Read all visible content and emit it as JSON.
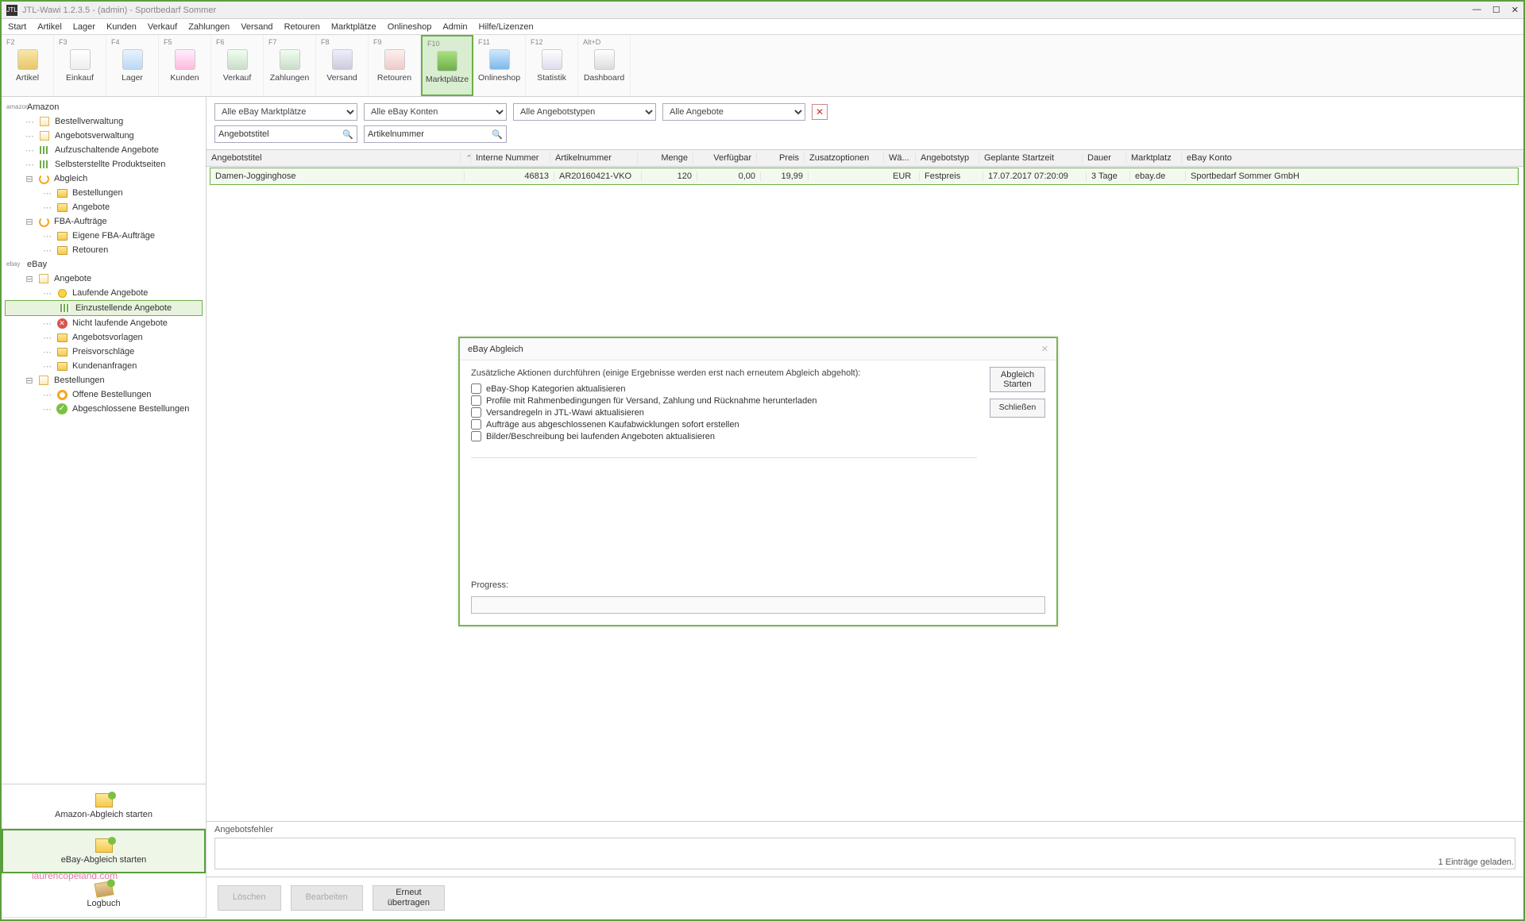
{
  "window": {
    "title": "JTL-Wawi 1.2.3.5 - (admin) - Sportbedarf Sommer",
    "app_badge": "JTL"
  },
  "menu": [
    "Start",
    "Artikel",
    "Lager",
    "Kunden",
    "Verkauf",
    "Zahlungen",
    "Versand",
    "Retouren",
    "Marktplätze",
    "Onlineshop",
    "Admin",
    "Hilfe/Lizenzen"
  ],
  "ribbon": [
    {
      "key": "F2",
      "label": "Artikel"
    },
    {
      "key": "F3",
      "label": "Einkauf"
    },
    {
      "key": "F4",
      "label": "Lager"
    },
    {
      "key": "F5",
      "label": "Kunden"
    },
    {
      "key": "F6",
      "label": "Verkauf"
    },
    {
      "key": "F7",
      "label": "Zahlungen"
    },
    {
      "key": "F8",
      "label": "Versand"
    },
    {
      "key": "F9",
      "label": "Retouren"
    },
    {
      "key": "F10",
      "label": "Marktplätze",
      "active": true
    },
    {
      "key": "F11",
      "label": "Onlineshop"
    },
    {
      "key": "F12",
      "label": "Statistik"
    },
    {
      "key": "Alt+D",
      "label": "Dashboard"
    }
  ],
  "sidebar": {
    "amazon": {
      "header": "Amazon",
      "items": [
        {
          "label": "Bestellverwaltung"
        },
        {
          "label": "Angebotsverwaltung"
        },
        {
          "label": "Aufzuschaltende Angebote",
          "icon": "bars"
        },
        {
          "label": "Selbsterstellte Produktseiten",
          "icon": "bars"
        }
      ],
      "abgleich": {
        "label": "Abgleich",
        "children": [
          {
            "label": "Bestellungen"
          },
          {
            "label": "Angebote"
          }
        ]
      },
      "fba": {
        "label": "FBA-Aufträge",
        "children": [
          {
            "label": "Eigene FBA-Aufträge"
          },
          {
            "label": "Retouren"
          }
        ]
      }
    },
    "ebay": {
      "header": "eBay",
      "angebote": {
        "label": "Angebote",
        "children": [
          {
            "label": "Laufende Angebote",
            "icon": "yell"
          },
          {
            "label": "Einzustellende Angebote",
            "icon": "bars",
            "selected": true
          },
          {
            "label": "Nicht laufende Angebote",
            "icon": "red"
          },
          {
            "label": "Angebotsvorlagen"
          },
          {
            "label": "Preisvorschläge"
          },
          {
            "label": "Kundenanfragen"
          }
        ]
      },
      "bestellungen": {
        "label": "Bestellungen",
        "children": [
          {
            "label": "Offene Bestellungen",
            "icon": "ring"
          },
          {
            "label": "Abgeschlossene Bestellungen",
            "icon": "check"
          }
        ]
      }
    },
    "actions": {
      "amazon": "Amazon-Abgleich starten",
      "ebay": "eBay-Abgleich starten",
      "log": "Logbuch"
    }
  },
  "filters": {
    "marketplaces": "Alle eBay Marktplätze",
    "accounts": "Alle eBay Konten",
    "types": "Alle Angebotstypen",
    "offers": "Alle Angebote",
    "search_title": "Angebotstitel",
    "search_artnum": "Artikelnummer"
  },
  "grid": {
    "headers": {
      "title": "Angebotstitel",
      "inum": "Interne Nummer",
      "anum": "Artikelnummer",
      "menge": "Menge",
      "verf": "Verfügbar",
      "preis": "Preis",
      "opt": "Zusatzoptionen",
      "wae": "Wä...",
      "atyp": "Angebotstyp",
      "start": "Geplante Startzeit",
      "dauer": "Dauer",
      "mkt": "Marktplatz",
      "konto": "eBay Konto"
    },
    "row": {
      "title": "Damen-Jogginghose",
      "inum": "46813",
      "anum": "AR20160421-VKO",
      "menge": "120",
      "verf": "0,00",
      "preis": "19,99",
      "opt": "",
      "wae": "EUR",
      "atyp": "Festpreis",
      "start": "17.07.2017 07:20:09",
      "dauer": "3 Tage",
      "mkt": "ebay.de",
      "konto": "Sportbedarf Sommer GmbH"
    }
  },
  "errors": {
    "label": "Angebotsfehler"
  },
  "status": "1 Einträge geladen.",
  "bottom_buttons": {
    "delete": "Löschen",
    "edit": "Bearbeiten",
    "retry1": "Erneut",
    "retry2": "übertragen"
  },
  "dialog": {
    "title": "eBay Abgleich",
    "intro": "Zusätzliche Aktionen durchführen (einige Ergebnisse werden erst nach erneutem Abgleich abgeholt):",
    "checks": [
      "eBay-Shop Kategorien aktualisieren",
      "Profile mit Rahmenbedingungen für Versand, Zahlung und Rücknahme herunterladen",
      "Versandregeln in JTL-Wawi aktualisieren",
      "Aufträge aus abgeschlossenen Kaufabwicklungen sofort erstellen",
      "Bilder/Beschreibung bei laufenden Angeboten aktualisieren"
    ],
    "btn_start1": "Abgleich",
    "btn_start2": "Starten",
    "btn_close": "Schließen",
    "progress": "Progress:"
  },
  "watermark": "laurencopeland.com"
}
